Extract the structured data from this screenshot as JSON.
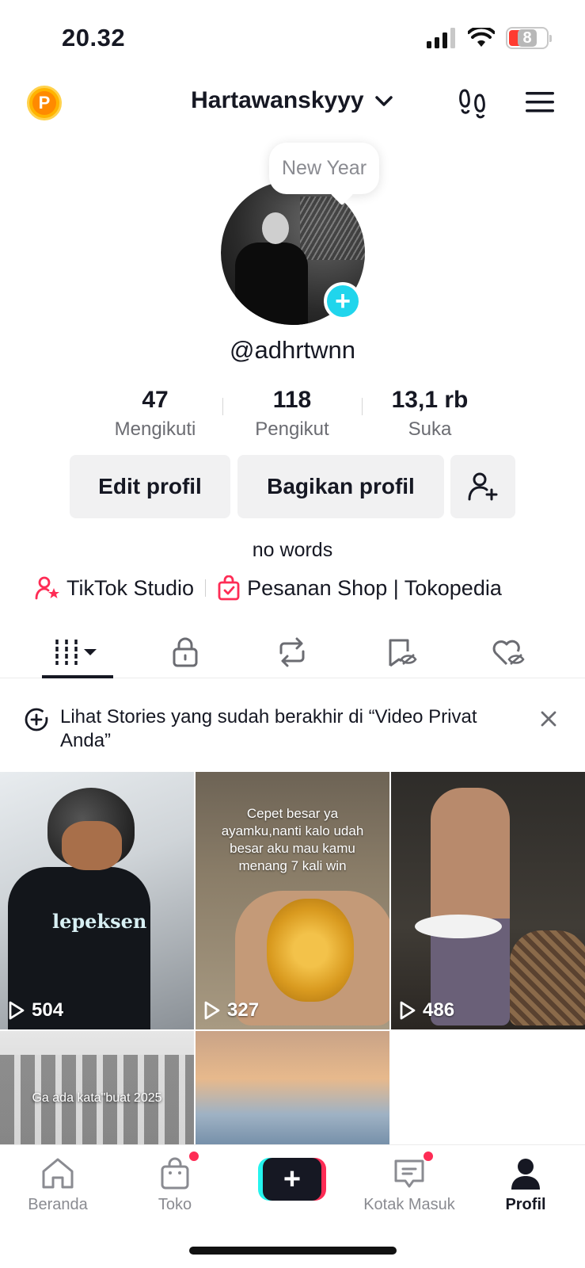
{
  "status_bar": {
    "time": "20.32",
    "battery": "8"
  },
  "header": {
    "coin_letter": "P",
    "username": "Hartawanskyyy"
  },
  "profile": {
    "bubble": "New Year",
    "handle": "@adhrtwnn",
    "bio": "no words"
  },
  "stats": [
    {
      "value": "47",
      "label": "Mengikuti"
    },
    {
      "value": "118",
      "label": "Pengikut"
    },
    {
      "value": "13,1 rb",
      "label": "Suka"
    }
  ],
  "actions": {
    "edit": "Edit profil",
    "share": "Bagikan profil"
  },
  "links": {
    "studio": "TikTok Studio",
    "shop": "Pesanan Shop | Tokopedia"
  },
  "banner": {
    "text": "Lihat Stories yang sudah berakhir di “Video Privat Anda”"
  },
  "videos": [
    {
      "views": "504",
      "shirt_text": "lepeksen"
    },
    {
      "views": "327",
      "caption": "Cepet besar ya ayamku,nanti kalo udah besar aku mau kamu menang 7 kali win"
    },
    {
      "views": "486"
    },
    {
      "caption": "Ga ada kata\"buat 2025"
    },
    {}
  ],
  "bottom_nav": [
    {
      "label": "Beranda",
      "icon": "home-icon"
    },
    {
      "label": "Toko",
      "icon": "shop-bag-icon"
    },
    {
      "label": "",
      "icon": "plus-icon"
    },
    {
      "label": "Kotak Masuk",
      "icon": "inbox-icon"
    },
    {
      "label": "Profil",
      "icon": "profile-icon"
    }
  ],
  "colors": {
    "accent_red": "#fe2c55",
    "accent_cyan": "#20d5ec",
    "text": "#161823",
    "muted": "#8a8b91"
  }
}
